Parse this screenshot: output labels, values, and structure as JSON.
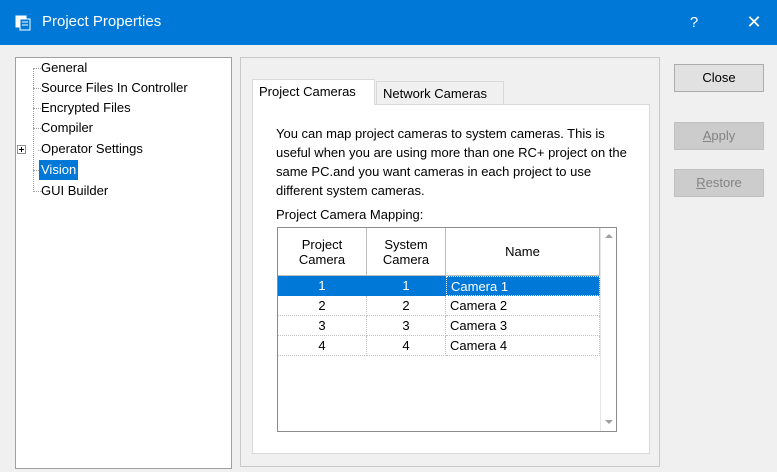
{
  "window": {
    "title": "Project Properties",
    "help": "?",
    "close": "✕"
  },
  "tree": {
    "items": [
      {
        "label": "General"
      },
      {
        "label": "Source Files In Controller"
      },
      {
        "label": "Encrypted Files"
      },
      {
        "label": "Compiler"
      },
      {
        "label": "Operator Settings"
      },
      {
        "label": "Vision"
      },
      {
        "label": "GUI Builder"
      }
    ],
    "selected": "Vision"
  },
  "tabs": {
    "active": "Project Cameras",
    "inactive": "Network Cameras"
  },
  "content": {
    "description": "You can map project cameras to system cameras. This is useful when you are using more than one RC+ project on the same PC.and you want cameras in each project to use different system cameras.",
    "mapping_label": "Project Camera Mapping:"
  },
  "table": {
    "headers": [
      "Project Camera",
      "System Camera",
      "Name"
    ],
    "rows": [
      [
        "1",
        "1",
        "Camera 1"
      ],
      [
        "2",
        "2",
        "Camera 2"
      ],
      [
        "3",
        "3",
        "Camera 3"
      ],
      [
        "4",
        "4",
        "Camera 4"
      ]
    ],
    "selected_row": 0
  },
  "buttons": {
    "close": "Close",
    "apply_first": "A",
    "apply_rest": "pply",
    "restore_first": "R",
    "restore_rest": "estore"
  },
  "colors": {
    "accent": "#0078d7"
  }
}
